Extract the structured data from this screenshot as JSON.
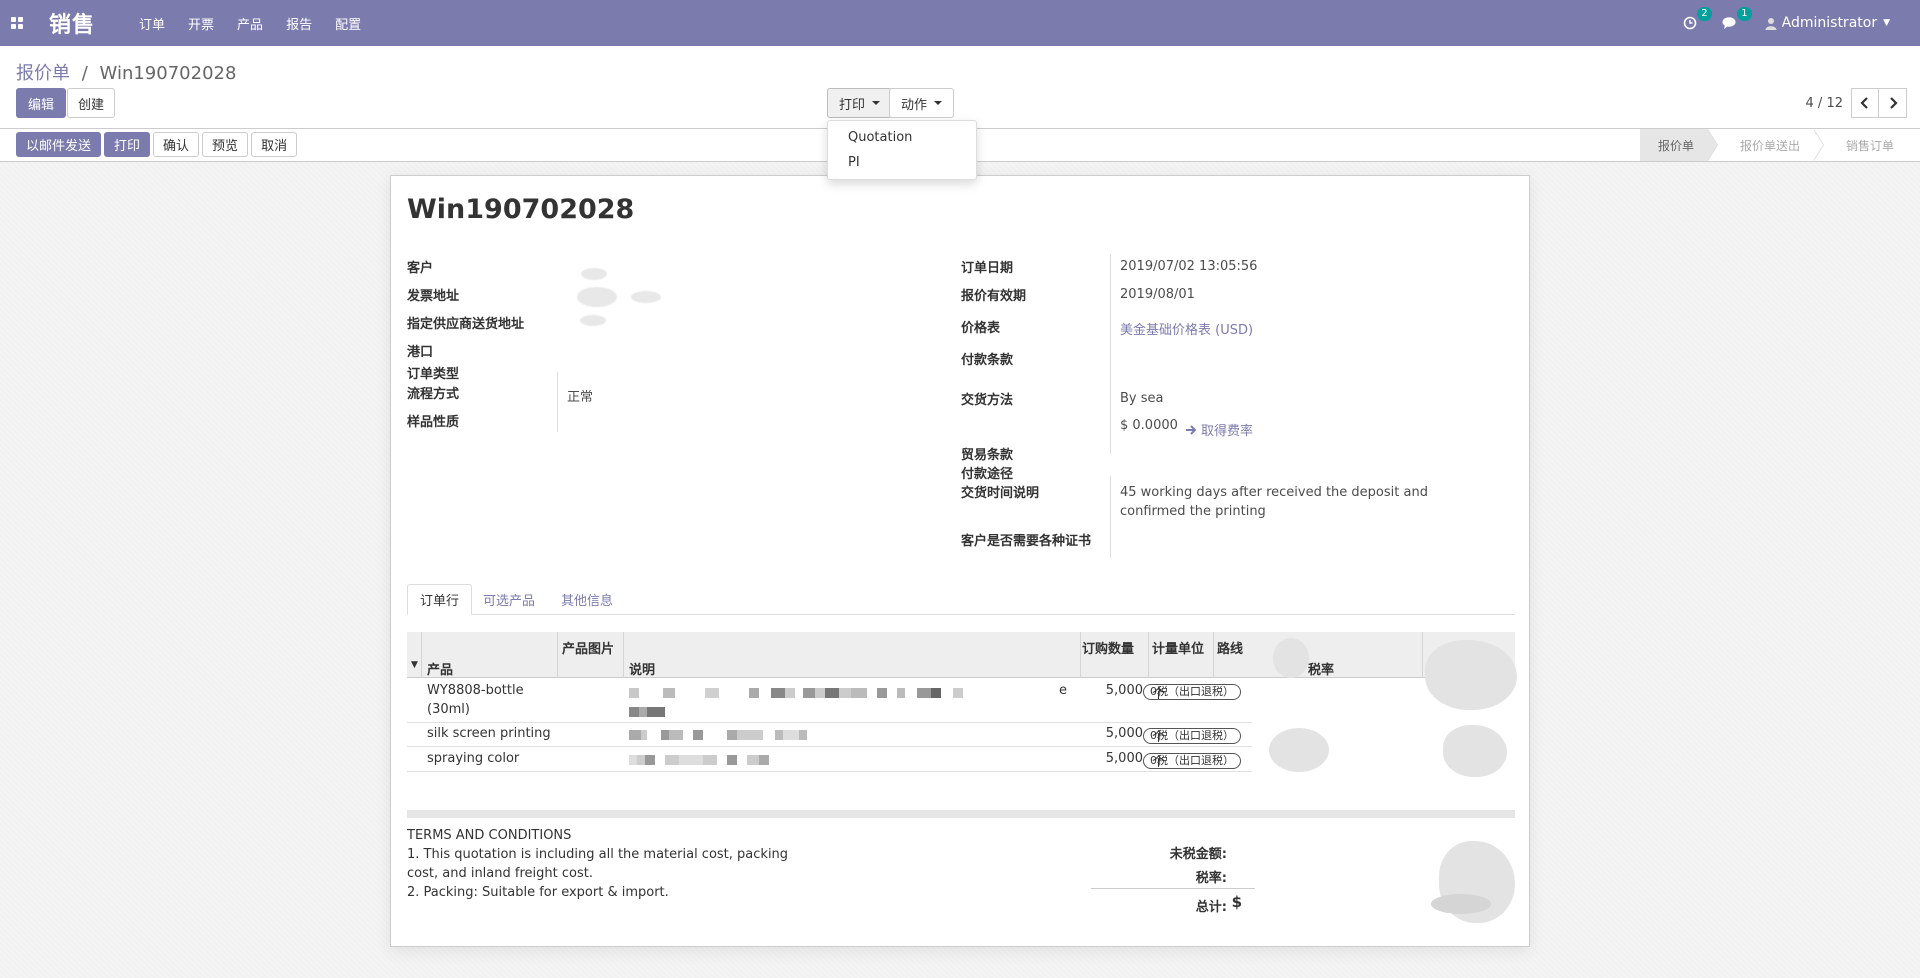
{
  "topbar": {
    "app_name": "销售",
    "menu": [
      "订单",
      "开票",
      "产品",
      "报告",
      "配置"
    ],
    "activity_count": "2",
    "messages_count": "1",
    "user": "Administrator"
  },
  "control_panel": {
    "breadcrumb_parent": "报价单",
    "breadcrumb_sep": "/",
    "breadcrumb_current": "Win190702028",
    "edit_label": "编辑",
    "create_label": "创建",
    "print_label": "打印",
    "action_label": "动作",
    "pager_value": "4 / 12"
  },
  "print_menu": {
    "items": [
      "Quotation",
      "PI"
    ]
  },
  "statusbar": {
    "buttons": [
      "以邮件发送",
      "打印",
      "确认",
      "预览",
      "取消"
    ],
    "stages": [
      "报价单",
      "报价单送出",
      "销售订单"
    ]
  },
  "form": {
    "title": "Win190702028",
    "left_labels": [
      "客户",
      "发票地址",
      "指定供应商送货地址",
      "港口",
      "订单类型",
      "流程方式",
      "样品性质"
    ],
    "process_value": "正常",
    "right_labels": [
      "订单日期",
      "报价有效期",
      "价格表",
      "付款条款",
      "交货方法",
      "贸易条款",
      "付款途径",
      "交货时间说明",
      "客户是否需要各种证书"
    ],
    "order_date": "2019/07/02 13:05:56",
    "validity_date": "2019/08/01",
    "pricelist": "美金基础价格表 (USD)",
    "delivery_method": "By sea",
    "delivery_cost": "$ 0.0000",
    "get_rate": "取得费率",
    "delivery_note_line1": "45 working days after received the deposit and",
    "delivery_note_line2": "confirmed the printing"
  },
  "tabs": [
    "订单行",
    "可选产品",
    "其他信息"
  ],
  "order_lines": {
    "headers": {
      "product": "产品",
      "image": "产品图片",
      "description": "说明",
      "qty": "订购数量",
      "uom": "计量单位",
      "route": "路线",
      "tax": "税率"
    },
    "rows": [
      {
        "product_line1": "WY8808-bottle",
        "product_line2": "(30ml)",
        "desc_suffix": "e",
        "qty": "5,000",
        "uom": "个",
        "tax": "0税（出口退税）"
      },
      {
        "product_line1": "silk screen printing",
        "product_line2": "",
        "desc_suffix": "",
        "qty": "5,000",
        "uom": "个",
        "tax": "0税（出口退税）"
      },
      {
        "product_line1": "spraying color",
        "product_line2": "",
        "desc_suffix": "",
        "qty": "5,000",
        "uom": "个",
        "tax": "0税（出口退税）"
      }
    ]
  },
  "terms": {
    "heading": "TERMS AND CONDITIONS",
    "line1": "1. This quotation is including all the material cost, packing",
    "line2": "cost, and inland freight cost.",
    "line3": "2. Packing: Suitable for export & import."
  },
  "totals": {
    "untaxed_label": "未税金额:",
    "tax_label": "税率:",
    "total_label": "总计:",
    "total_currency": "$"
  },
  "colors": {
    "brand": "#7c7bad",
    "badge": "#00a09d"
  }
}
